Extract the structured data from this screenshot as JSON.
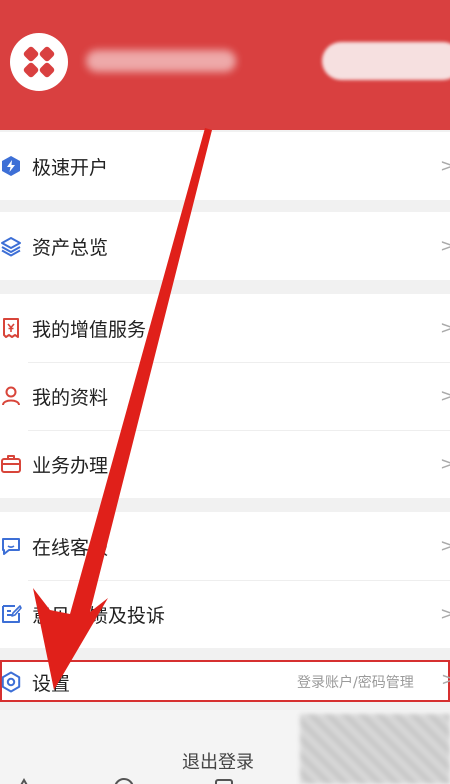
{
  "header": {
    "user_name": "",
    "pill_label": ""
  },
  "menu": {
    "group1": [
      {
        "label": "极速开户",
        "icon": "lightning-icon"
      }
    ],
    "group2": [
      {
        "label": "资产总览",
        "icon": "layers-icon"
      }
    ],
    "group3": [
      {
        "label": "我的增值服务",
        "icon": "yen-receipt-icon"
      },
      {
        "label": "我的资料",
        "icon": "user-icon"
      },
      {
        "label": "业务办理",
        "icon": "briefcase-icon"
      }
    ],
    "group4": [
      {
        "label": "在线客服",
        "icon": "chat-icon"
      },
      {
        "label": "意见反馈及投诉",
        "icon": "feedback-icon"
      }
    ],
    "chevron": ">"
  },
  "settings": {
    "label": "设置",
    "sub": "登录账户/密码管理",
    "icon": "gear-icon",
    "chevron": ">"
  },
  "footer": {
    "logout_label": "退出登录"
  },
  "colors": {
    "brand_red": "#d94040",
    "icon_blue": "#3d6fd6",
    "icon_red": "#d8453a",
    "arrow_red": "#e0201a"
  }
}
